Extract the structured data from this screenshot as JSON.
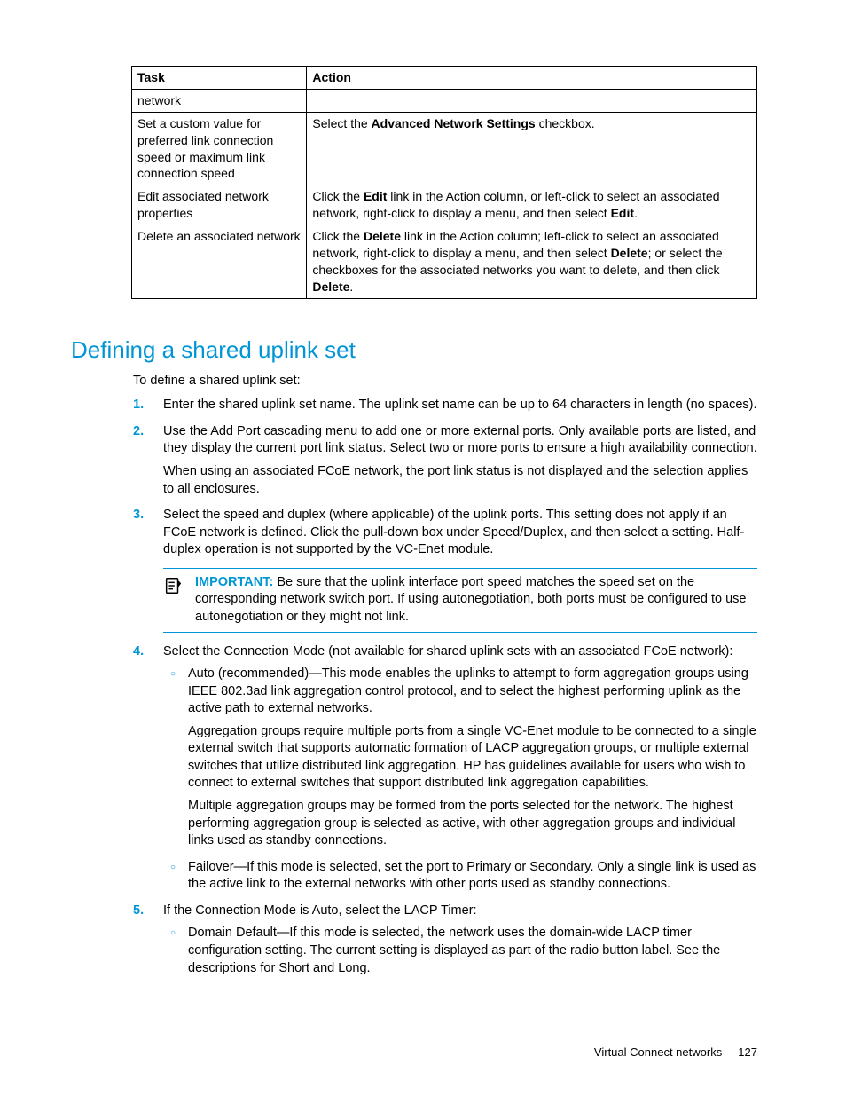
{
  "table": {
    "headers": {
      "task": "Task",
      "action": "Action"
    },
    "rows": [
      {
        "task": "network",
        "action": ""
      },
      {
        "task": "Set a custom value for preferred link connection speed or maximum link connection speed",
        "action_pre": "Select the ",
        "action_b1": "Advanced Network Settings",
        "action_post": " checkbox."
      },
      {
        "task": "Edit associated network properties",
        "a1": "Click the ",
        "b1": "Edit",
        "a2": " link in the Action column, or left-click to select an associated network, right-click to display a menu, and then select ",
        "b2": "Edit",
        "a3": "."
      },
      {
        "task": "Delete an associated network",
        "a1": "Click the ",
        "b1": "Delete",
        "a2": " link in the Action column; left-click to select an associated network, right-click to display a menu, and then select ",
        "b2": "Delete",
        "a3": "; or select the checkboxes for the associated networks you want to delete, and then click ",
        "b3": "Delete",
        "a4": "."
      }
    ]
  },
  "heading": "Defining a shared uplink set",
  "intro": "To define a shared uplink set:",
  "steps": {
    "s1": "Enter the shared uplink set name. The uplink set name can be up to 64 characters in length (no spaces).",
    "s2a": "Use the Add Port cascading menu to add one or more external ports. Only available ports are listed, and they display the current port link status. Select two or more ports to ensure a high availability connection.",
    "s2b": "When using an associated FCoE network, the port link status is not displayed and the selection applies to all enclosures.",
    "s3": "Select the speed and duplex (where applicable) of the uplink ports. This setting does not apply if an FCoE network is defined. Click the pull-down box under Speed/Duplex, and then select a setting. Half-duplex operation is not supported by the VC-Enet module.",
    "important_label": "IMPORTANT:",
    "important_body": "Be sure that the uplink interface port speed matches the speed set on the corresponding network switch port. If using autonegotiation, both ports must be configured to use autonegotiation or they might not link.",
    "s4": "Select the Connection Mode (not available for shared uplink sets with an associated FCoE network):",
    "s4_auto_a": "Auto (recommended)—This mode enables the uplinks to attempt to form aggregation groups using IEEE 802.3ad link aggregation control protocol, and to select the highest performing uplink as the active path to external networks.",
    "s4_auto_b": "Aggregation groups require multiple ports from a single VC-Enet module to be connected to a single external switch that supports automatic formation of LACP aggregation groups, or multiple external switches that utilize distributed link aggregation. HP has guidelines available for users who wish to connect to external switches that support distributed link aggregation capabilities.",
    "s4_auto_c": "Multiple aggregation groups may be formed from the ports selected for the network. The highest performing aggregation group is selected as active, with other aggregation groups and individual links used as standby connections.",
    "s4_failover": "Failover—If this mode is selected, set the port to Primary or Secondary. Only a single link is used as the active link to the external networks with other ports used as standby connections.",
    "s5": "If the Connection Mode is Auto, select the LACP Timer:",
    "s5_domain": "Domain Default—If this mode is selected, the network uses the domain-wide LACP timer configuration setting. The current setting is displayed as part of the radio button label. See the descriptions for Short and Long."
  },
  "footer": {
    "section": "Virtual Connect networks",
    "page": "127"
  }
}
